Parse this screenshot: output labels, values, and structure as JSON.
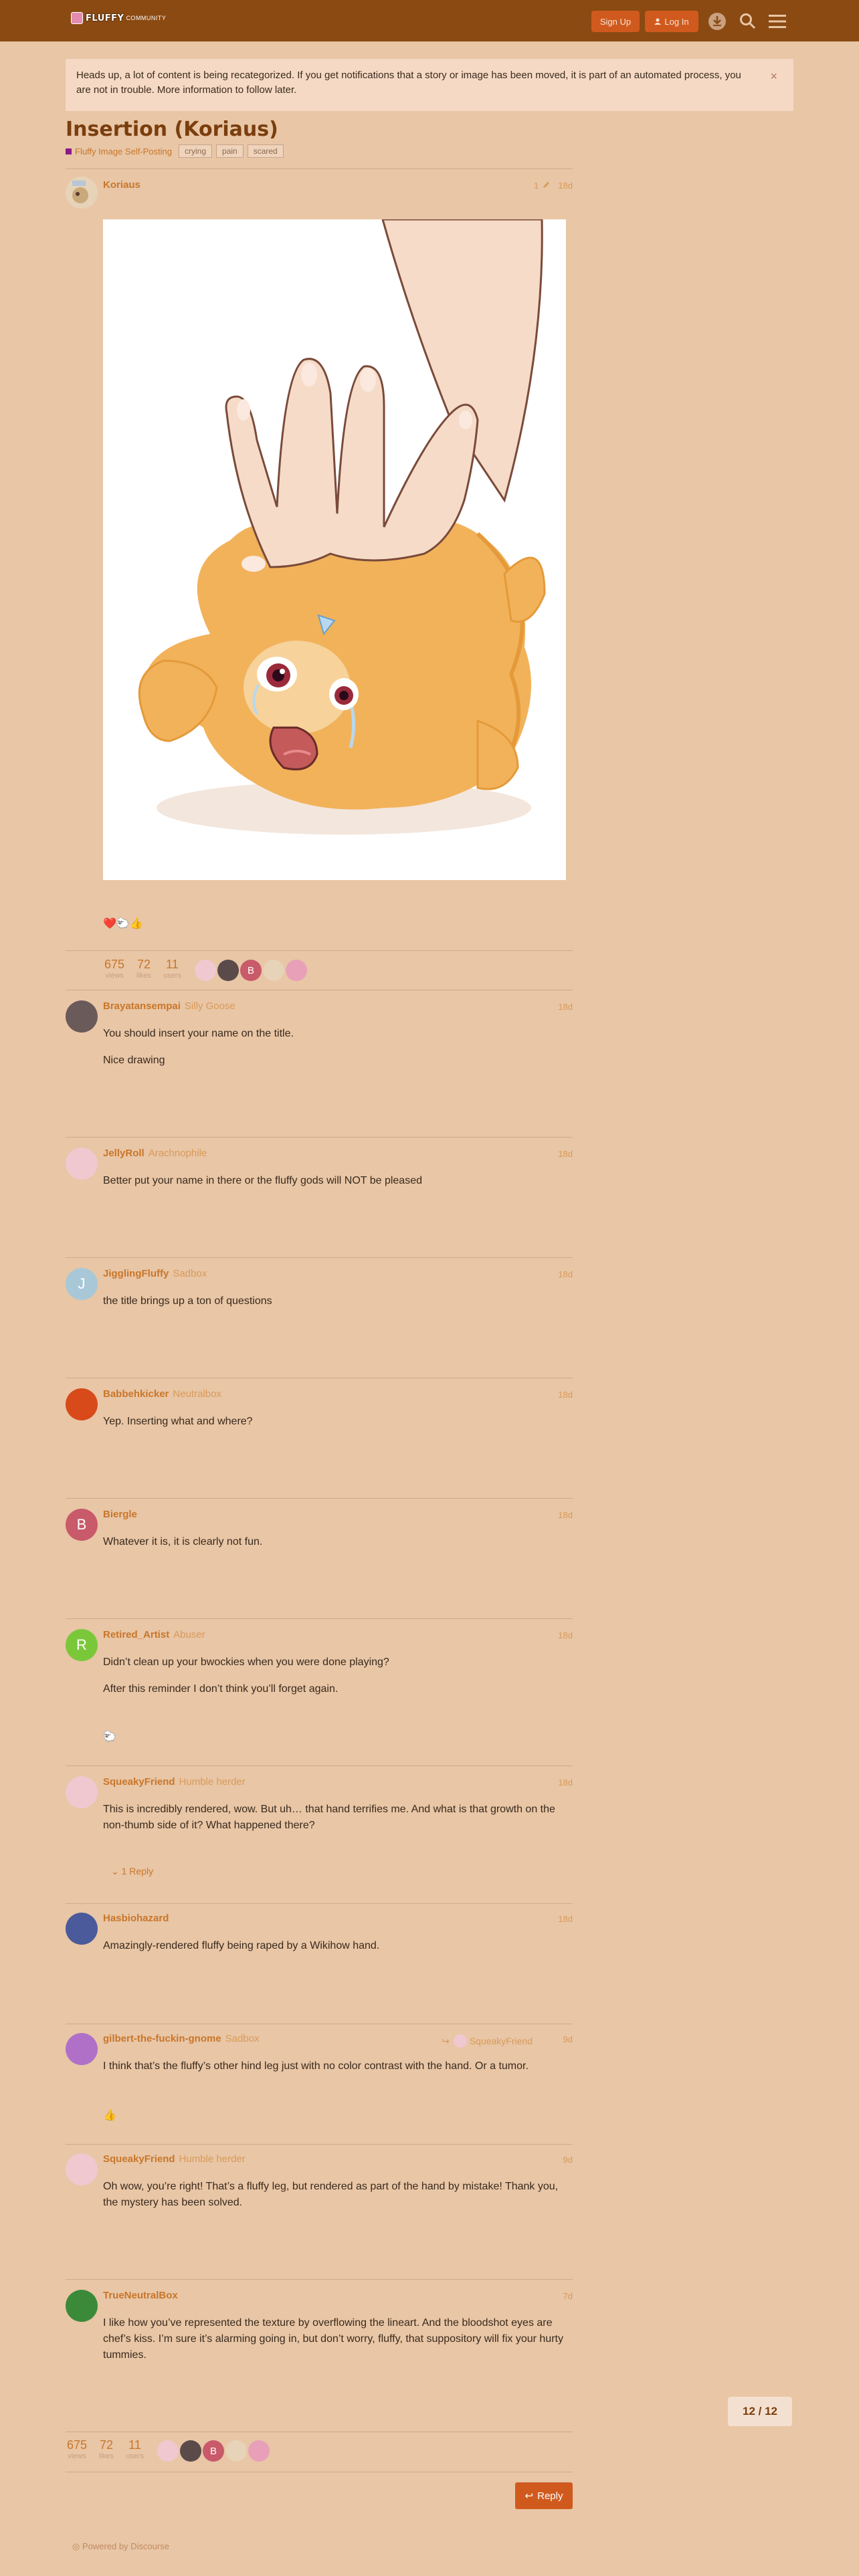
{
  "header": {
    "logo_text": "FLUFFY",
    "logo_sub": "COMMUNITY",
    "signup": "Sign Up",
    "login": "Log In"
  },
  "banner": {
    "text": "Heads up, a lot of content is being recategorized. If you get notifications that a story or image has been moved, it is part of an automated process, you are not in trouble. More information to follow later.",
    "close": "×"
  },
  "topic": {
    "title": "Insertion (Koriaus)",
    "category": "Fluffy Image Self-Posting",
    "tags": [
      "crying",
      "pain",
      "scared"
    ]
  },
  "op": {
    "author": "Koriaus",
    "edits": "1",
    "date": "18d",
    "reactions": "❤️🐑👍",
    "stats": [
      {
        "num": "675",
        "label": "views"
      },
      {
        "num": "72",
        "label": "likes"
      },
      {
        "num": "11",
        "label": "users"
      }
    ]
  },
  "posts": [
    {
      "author": "Brayatansempai",
      "title": "Silly Goose",
      "date": "18d",
      "lines": [
        "You should insert your name on the title.",
        "Nice drawing"
      ]
    },
    {
      "author": "JellyRoll",
      "title": "Arachnophile",
      "date": "18d",
      "lines": [
        "Better put your name in there or the fluffy gods will NOT be pleased"
      ]
    },
    {
      "author": "JigglingFluffy",
      "title": "Sadbox",
      "date": "18d",
      "lines": [
        "the title brings up a ton of questions"
      ]
    },
    {
      "author": "Babbehkicker",
      "title": "Neutralbox",
      "date": "18d",
      "lines": [
        "Yep. Inserting what and where?"
      ]
    },
    {
      "author": "Biergle",
      "title": "",
      "date": "18d",
      "lines": [
        "Whatever it is, it is clearly not fun."
      ]
    },
    {
      "author": "Retired_Artist",
      "title": "Abuser",
      "date": "18d",
      "lines": [
        "Didn’t clean up your bwockies when you were done playing?",
        "After this reminder I don’t think you’ll forget again."
      ],
      "reaction": "🐑"
    },
    {
      "author": "SqueakyFriend",
      "title": "Humble herder",
      "date": "18d",
      "lines": [
        "This is incredibly rendered, wow. But uh… that hand terrifies me. And what is that growth on the non-thumb side of it? What happened there?"
      ],
      "replies": "1 Reply"
    },
    {
      "author": "Hasbiohazard",
      "title": "",
      "date": "18d",
      "lines": [
        "Amazingly-rendered fluffy being raped by a Wikihow hand."
      ]
    },
    {
      "author": "gilbert-the-fuckin-gnome",
      "title": "Sadbox",
      "date": "9d",
      "reply_to": "SqueakyFriend",
      "lines": [
        "I think that’s the fluffy’s other hind leg just with no color contrast with the hand. Or a tumor."
      ],
      "reaction": "👍"
    },
    {
      "author": "SqueakyFriend",
      "title": "Humble herder",
      "date": "9d",
      "lines": [
        "Oh wow, you’re right! That’s a fluffy leg, but rendered as part of the hand by mistake! Thank you, the mystery has been solved."
      ]
    },
    {
      "author": "TrueNeutralBox",
      "title": "",
      "date": "7d",
      "lines": [
        "I like how you’ve represented the texture by overflowing the lineart. And the bloodshot eyes are chef’s kiss. I’m sure it’s alarming going in, but don’t worry, fluffy, that suppository will fix your hurty tummies."
      ]
    }
  ],
  "footer": {
    "progress": "12 / 12",
    "reply": "Reply",
    "powered": "Powered by Discourse"
  }
}
